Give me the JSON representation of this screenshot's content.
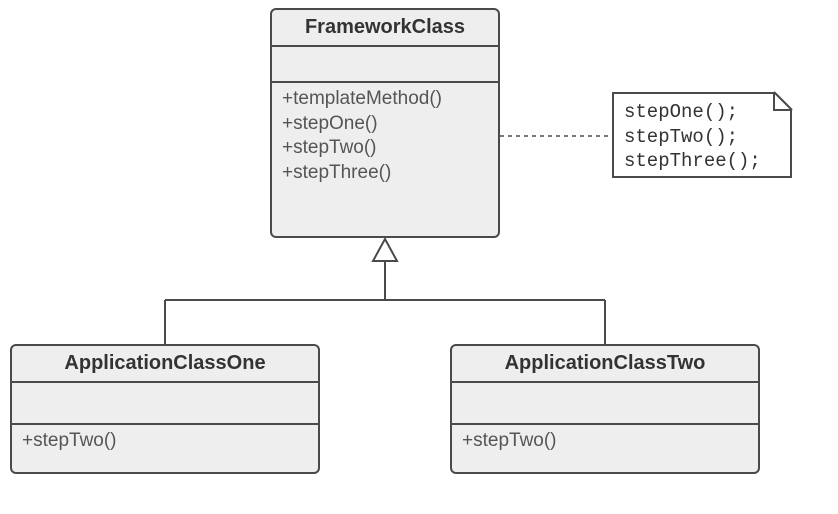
{
  "framework": {
    "title": "FrameworkClass",
    "methods": {
      "m1": "+templateMethod()",
      "m2": "+stepOne()",
      "m3": "+stepTwo()",
      "m4": "+stepThree()"
    }
  },
  "appOne": {
    "title": "ApplicationClassOne",
    "method": "+stepTwo()"
  },
  "appTwo": {
    "title": "ApplicationClassTwo",
    "method": "+stepTwo()"
  },
  "note": {
    "l1": "stepOne();",
    "l2": "stepTwo();",
    "l3": "stepThree();"
  }
}
